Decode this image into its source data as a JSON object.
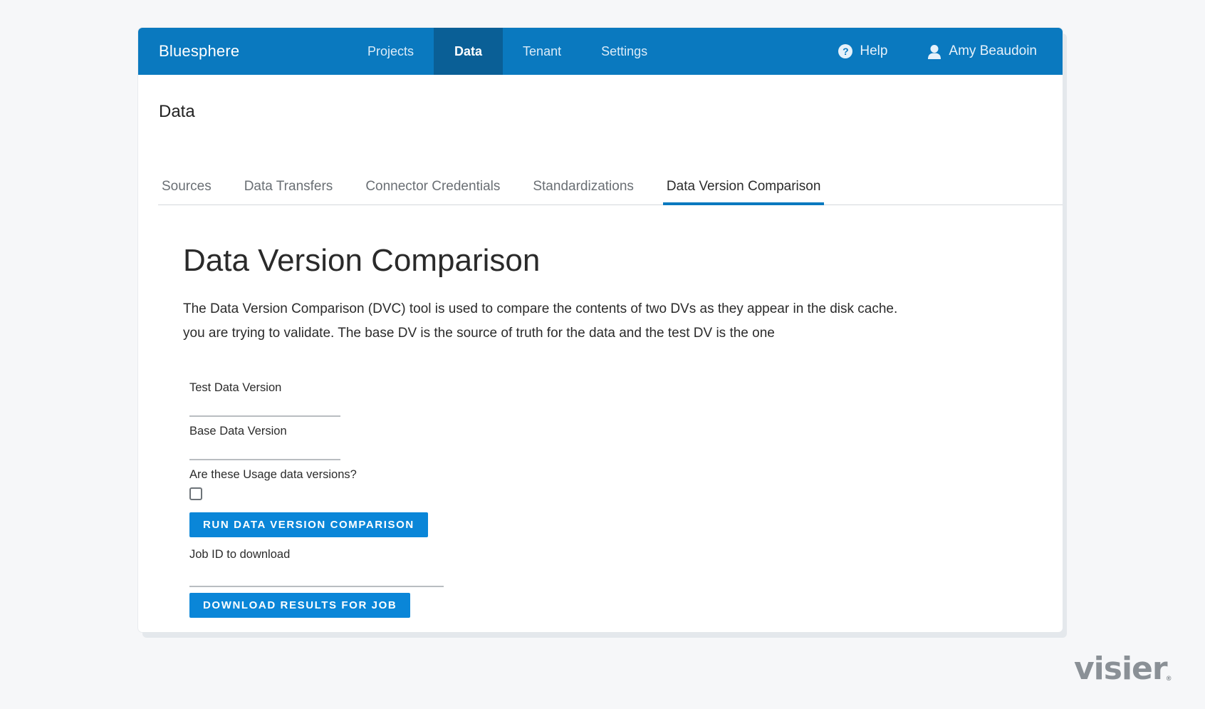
{
  "app": {
    "brand": "Bluesphere",
    "nav": [
      {
        "label": "Projects",
        "active": false
      },
      {
        "label": "Data",
        "active": true
      },
      {
        "label": "Tenant",
        "active": false
      },
      {
        "label": "Settings",
        "active": false
      }
    ],
    "help": {
      "label": "Help",
      "icon": "help-circle-icon"
    },
    "user": {
      "name": "Amy Beaudoin",
      "icon": "user-icon"
    },
    "accent_color": "#0a79bf"
  },
  "page": {
    "section_title": "Data",
    "tabs": [
      {
        "label": "Sources",
        "active": false
      },
      {
        "label": "Data Transfers",
        "active": false
      },
      {
        "label": "Connector Credentials",
        "active": false
      },
      {
        "label": "Standardizations",
        "active": false
      },
      {
        "label": "Data Version Comparison",
        "active": true
      }
    ],
    "heading": "Data Version Comparison",
    "description_line1": "The Data Version Comparison (DVC) tool is used to compare the contents of two DVs as they appear in the disk cache.",
    "description_line2": "you are trying to validate.  The base DV is the source of truth for the data and the test DV is the one"
  },
  "form": {
    "test_label": "Test Data Version",
    "test_value": "",
    "base_label": "Base Data Version",
    "base_value": "",
    "usage_label": "Are these Usage data versions?",
    "usage_checked": false,
    "run_button": "RUN DATA VERSION COMPARISON",
    "job_label": "Job ID to download",
    "job_value": "",
    "download_button": "DOWNLOAD RESULTS FOR JOB"
  },
  "watermark": "visier"
}
